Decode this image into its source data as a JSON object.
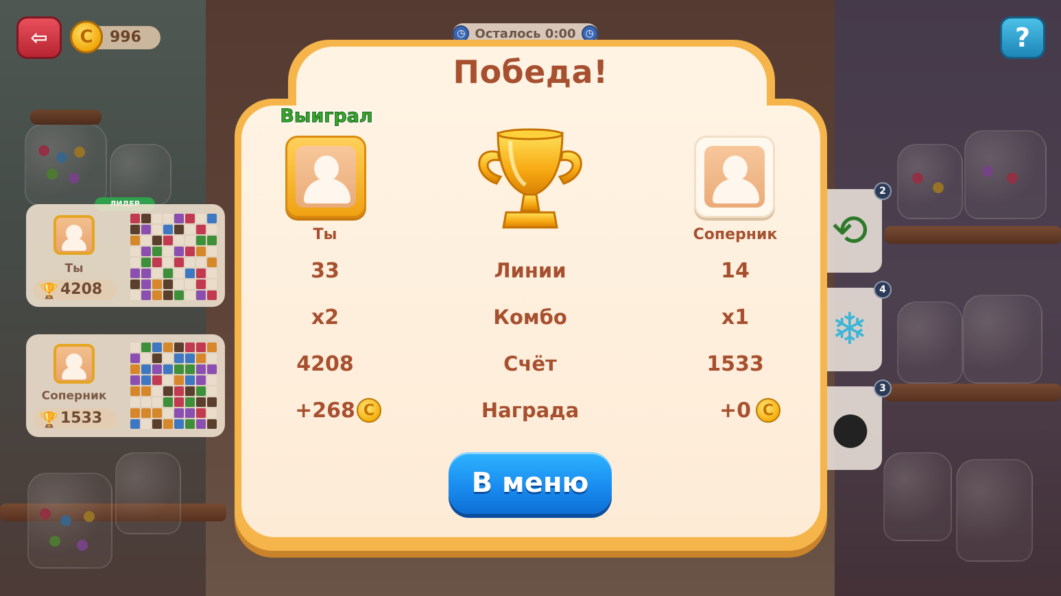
{
  "hud": {
    "coins": "996",
    "timer": "Осталось 0:00",
    "exit_icon": "exit-door-icon",
    "help_icon": "?"
  },
  "side_cards": {
    "leader_tag": "ЛИДЕР",
    "you": {
      "name": "Ты",
      "score": "4208"
    },
    "opponent": {
      "name": "Соперник",
      "score": "1533"
    }
  },
  "powerups": [
    {
      "name": "swap-arrows-icon",
      "count": "2"
    },
    {
      "name": "snowflake-icon",
      "count": "4"
    },
    {
      "name": "bomb-icon",
      "count": "3"
    }
  ],
  "modal": {
    "title": "Победа!",
    "won_label": "Выиграл",
    "you_name": "Ты",
    "opponent_name": "Соперник",
    "rows": [
      {
        "label": "Линии",
        "you": "33",
        "opponent": "14"
      },
      {
        "label": "Комбо",
        "you": "x2",
        "opponent": "x1"
      },
      {
        "label": "Счёт",
        "you": "4208",
        "opponent": "1533"
      },
      {
        "label": "Награда",
        "you": "+268",
        "opponent": "+0"
      }
    ],
    "coin_glyph": "C",
    "menu_button": "В меню"
  },
  "colors": {
    "title": "#a6502f",
    "won": "#38a72c",
    "button": "#1a8df0",
    "frame": "#f6b54a"
  }
}
